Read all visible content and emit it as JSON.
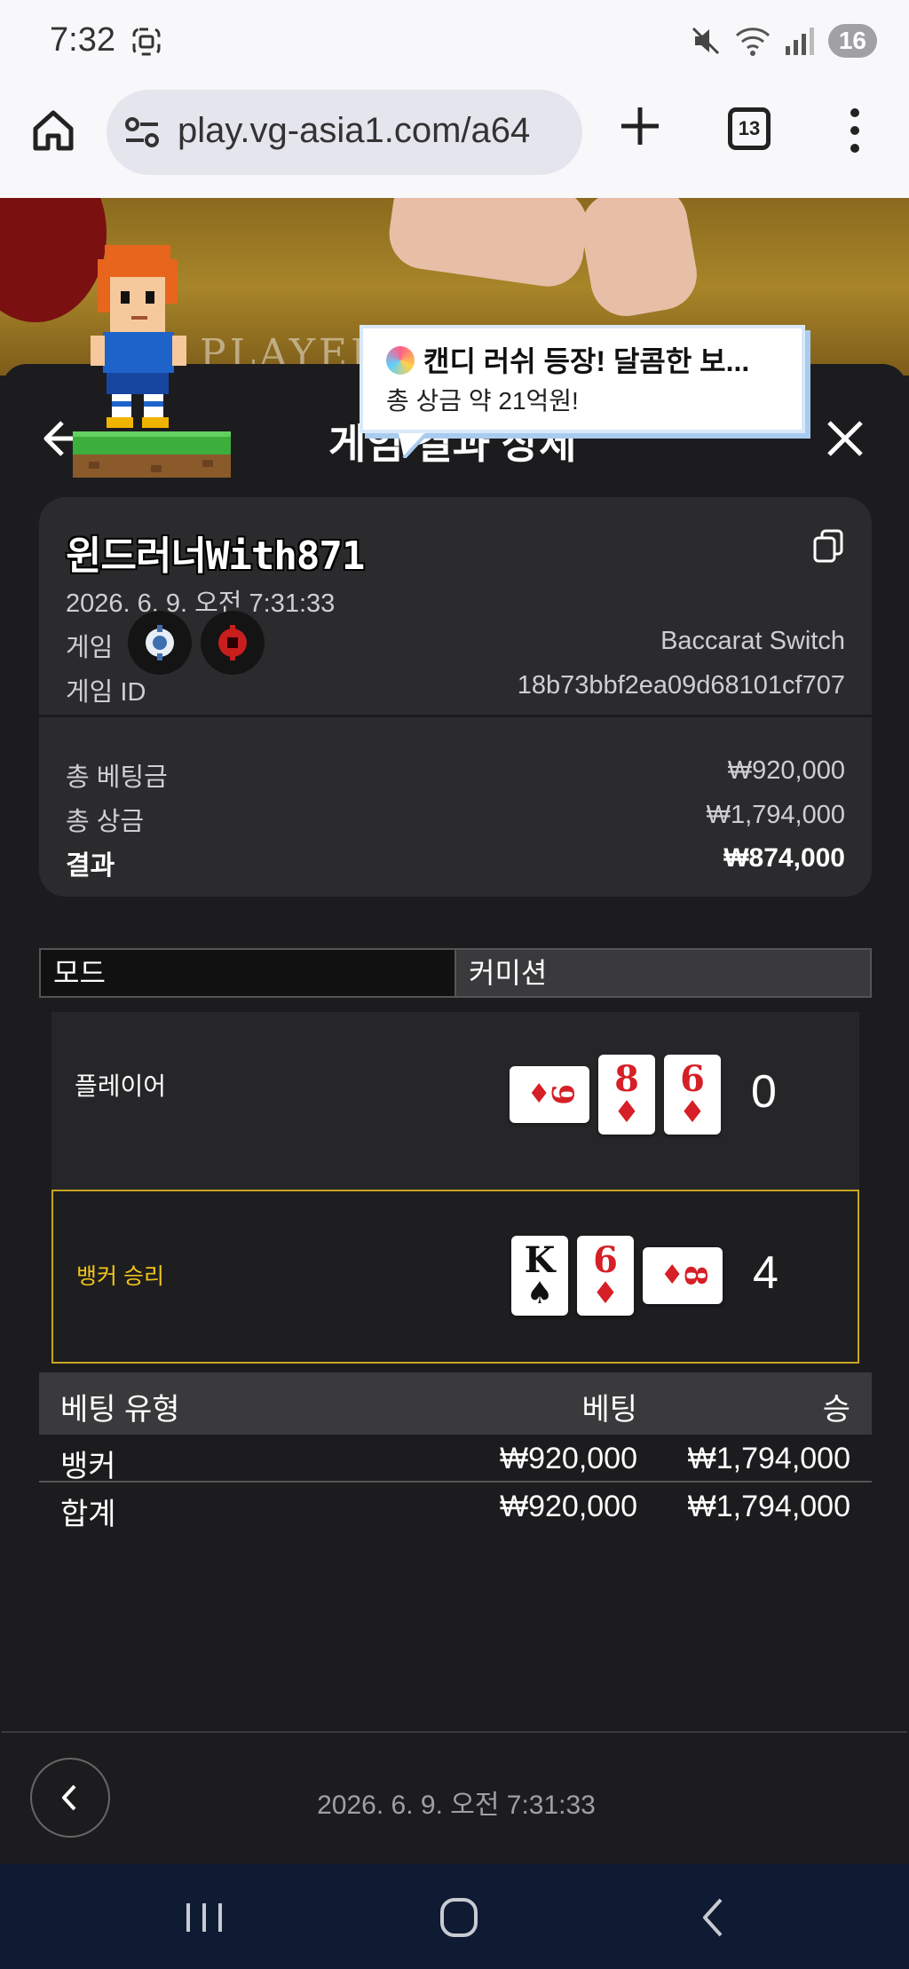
{
  "status": {
    "time": "7:32",
    "battery": "16"
  },
  "browser": {
    "url": "play.vg-asia1.com/a64",
    "tab_count": "13"
  },
  "background": {
    "table_text": "PLAYER"
  },
  "modal": {
    "title": "게임 결과 상세",
    "user_id": "윈드러너With871",
    "datetime": "2026. 6. 9. 오전 7:31:33",
    "game_label": "게임",
    "game_value": "Baccarat Switch",
    "game_id_label": "게임 ID",
    "game_id_value": "18b73bbf2ea09d68101cf707",
    "total_bet_label": "총 베팅금",
    "total_bet_value": "₩920,000",
    "total_win_label": "총 상금",
    "total_win_value": "₩1,794,000",
    "result_label": "결과",
    "result_value": "₩874,000"
  },
  "mode": {
    "left_label": "모드",
    "right_label": "커미션"
  },
  "result": {
    "player": {
      "label": "플레이어",
      "score": "0",
      "cards": [
        {
          "rank": "9",
          "suit": "♦",
          "orientation": "landscape",
          "color": "#d61f26"
        },
        {
          "rank": "8",
          "suit": "♦",
          "orientation": "portrait",
          "color": "#d61f26"
        },
        {
          "rank": "6",
          "suit": "♦",
          "orientation": "portrait",
          "color": "#d61f26"
        }
      ]
    },
    "banker": {
      "label": "뱅커 승리",
      "score": "4",
      "cards": [
        {
          "rank": "K",
          "suit": "♠",
          "orientation": "portrait",
          "color": "#111111"
        },
        {
          "rank": "6",
          "suit": "♦",
          "orientation": "portrait",
          "color": "#d61f26"
        },
        {
          "rank": "8",
          "suit": "♦",
          "orientation": "landscape",
          "color": "#d61f26"
        }
      ]
    }
  },
  "bets": {
    "headers": {
      "type": "베팅 유형",
      "bet": "베팅",
      "win": "승"
    },
    "rows": [
      {
        "type": "뱅커",
        "bet": "₩920,000",
        "win": "₩1,794,000"
      }
    ],
    "total": {
      "type": "합계",
      "bet": "₩920,000",
      "win": "₩1,794,000"
    }
  },
  "footer": {
    "datetime": "2026. 6. 9. 오전 7:31:33"
  },
  "promo": {
    "icon": "lollipop-icon",
    "title": "캔디 러쉬 등장! 달콤한 보...",
    "subtitle": "총 상금 약 21억원!"
  },
  "colors": {
    "accent_gold": "#f0c419",
    "red_suit": "#d61f26",
    "nav_bg": "#0f1a33"
  }
}
